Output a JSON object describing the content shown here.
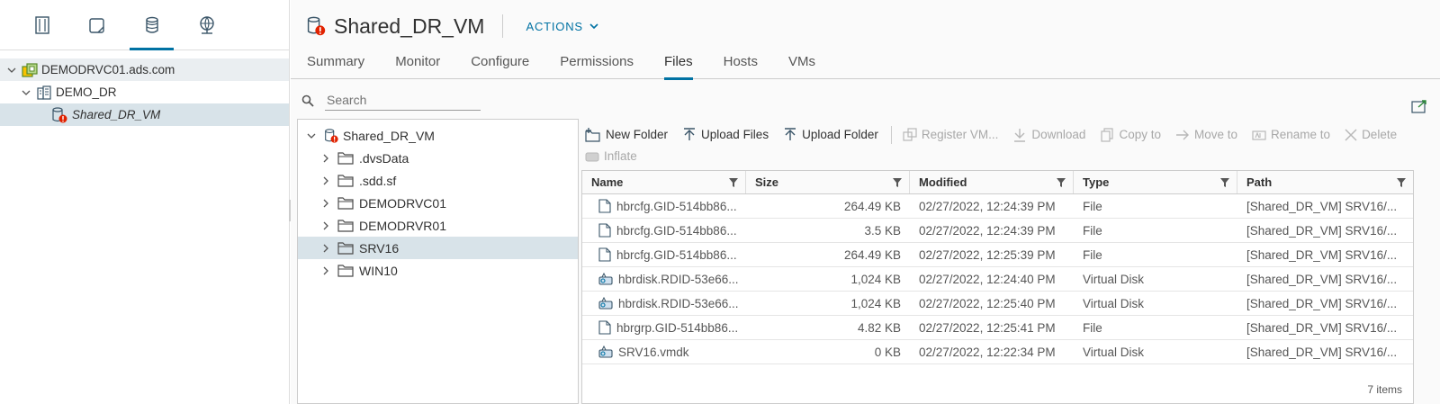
{
  "navigator": {
    "tabs": [
      {
        "icon": "hosts-clusters-icon"
      },
      {
        "icon": "vms-templates-icon"
      },
      {
        "icon": "storage-icon",
        "active": true
      },
      {
        "icon": "networking-icon"
      }
    ],
    "tree": {
      "vcenter": "DEMODRVC01.ads.com",
      "datacenter": "DEMO_DR",
      "datastore": "Shared_DR_VM"
    }
  },
  "header": {
    "title": "Shared_DR_VM",
    "actions_label": "ACTIONS"
  },
  "tabs": [
    "Summary",
    "Monitor",
    "Configure",
    "Permissions",
    "Files",
    "Hosts",
    "VMs"
  ],
  "active_tab": "Files",
  "search": {
    "placeholder": "Search"
  },
  "folder_tree": {
    "root": "Shared_DR_VM",
    "folders": [
      ".dvsData",
      ".sdd.sf",
      "DEMODRVC01",
      "DEMODRVR01",
      "SRV16",
      "WIN10"
    ],
    "selected": "SRV16"
  },
  "toolbar": {
    "new_folder": "New Folder",
    "upload_files": "Upload Files",
    "upload_folder": "Upload Folder",
    "register_vm": "Register VM...",
    "download": "Download",
    "copy_to": "Copy to",
    "move_to": "Move to",
    "rename_to": "Rename to",
    "delete": "Delete",
    "inflate": "Inflate"
  },
  "grid": {
    "columns": [
      "Name",
      "Size",
      "Modified",
      "Type",
      "Path"
    ],
    "rows": [
      {
        "name": "hbrcfg.GID-514bb86...",
        "size": "264.49 KB",
        "modified": "02/27/2022, 12:24:39 PM",
        "type": "File",
        "path": "[Shared_DR_VM] SRV16/...",
        "icon": "file-icon"
      },
      {
        "name": "hbrcfg.GID-514bb86...",
        "size": "3.5 KB",
        "modified": "02/27/2022, 12:24:39 PM",
        "type": "File",
        "path": "[Shared_DR_VM] SRV16/...",
        "icon": "file-icon"
      },
      {
        "name": "hbrcfg.GID-514bb86...",
        "size": "264.49 KB",
        "modified": "02/27/2022, 12:25:39 PM",
        "type": "File",
        "path": "[Shared_DR_VM] SRV16/...",
        "icon": "file-icon"
      },
      {
        "name": "hbrdisk.RDID-53e66...",
        "size": "1,024 KB",
        "modified": "02/27/2022, 12:24:40 PM",
        "type": "Virtual Disk",
        "path": "[Shared_DR_VM] SRV16/...",
        "icon": "virtual-disk-icon"
      },
      {
        "name": "hbrdisk.RDID-53e66...",
        "size": "1,024 KB",
        "modified": "02/27/2022, 12:25:40 PM",
        "type": "Virtual Disk",
        "path": "[Shared_DR_VM] SRV16/...",
        "icon": "virtual-disk-icon"
      },
      {
        "name": "hbrgrp.GID-514bb86...",
        "size": "4.82 KB",
        "modified": "02/27/2022, 12:25:41 PM",
        "type": "File",
        "path": "[Shared_DR_VM] SRV16/...",
        "icon": "file-icon"
      },
      {
        "name": "SRV16.vmdk",
        "size": "0 KB",
        "modified": "02/27/2022, 12:22:34 PM",
        "type": "Virtual Disk",
        "path": "[Shared_DR_VM] SRV16/...",
        "icon": "virtual-disk-icon"
      }
    ],
    "footer": "7 items"
  },
  "colors": {
    "accent": "#0072a3",
    "alert": "#e12200",
    "selection": "#d8e3e9",
    "folder": "#4b4b4b"
  }
}
